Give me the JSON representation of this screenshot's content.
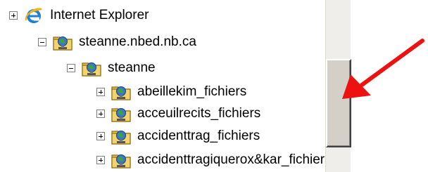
{
  "tree": {
    "items": [
      {
        "label": "Internet Explorer",
        "expander": "plus",
        "icon": "internet-explorer-icon"
      },
      {
        "label": "steanne.nbed.nb.ca",
        "expander": "minus",
        "icon": "web-folder-icon"
      },
      {
        "label": "steanne",
        "expander": "minus",
        "icon": "web-folder-icon"
      },
      {
        "label": "abeillekim_fichiers",
        "expander": "plus",
        "icon": "web-folder-icon"
      },
      {
        "label": "acceuilrecits_fichiers",
        "expander": "plus",
        "icon": "web-folder-icon"
      },
      {
        "label": "accidenttrag_fichiers",
        "expander": "plus",
        "icon": "web-folder-icon"
      },
      {
        "label": "accidenttragiquerox&kar_fichiers",
        "expander": "plus",
        "icon": "web-folder-icon"
      }
    ]
  },
  "scrollbar": {
    "thumb_state": "middle"
  },
  "annotation": {
    "arrow_color": "#ee1111",
    "arrow_icon": "red-arrow-icon"
  }
}
